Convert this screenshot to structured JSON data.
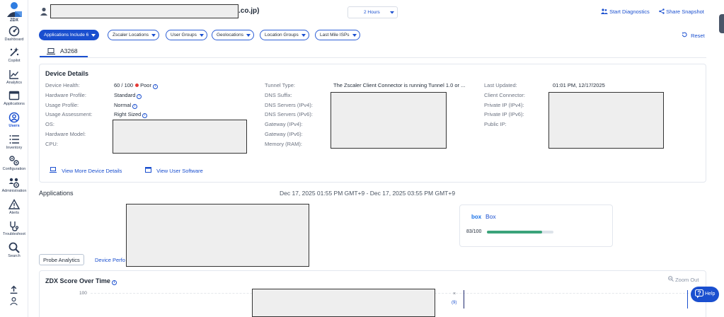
{
  "sidebar": {
    "logo_label": "ZDX",
    "items": [
      {
        "label": "Dashboard",
        "icon": "dashboard-icon"
      },
      {
        "label": "Copilot",
        "icon": "sparkle-icon"
      },
      {
        "label": "Analytics",
        "icon": "chart-icon"
      },
      {
        "label": "Applications",
        "icon": "window-icon"
      },
      {
        "label": "Users",
        "icon": "user-circle-icon",
        "active": true
      },
      {
        "label": "Inventory",
        "icon": "list-icon"
      },
      {
        "label": "Configuration",
        "icon": "gears-icon"
      },
      {
        "label": "Administration",
        "icon": "admin-icon"
      },
      {
        "label": "Alerts",
        "icon": "warning-icon"
      },
      {
        "label": "Troubleshoot",
        "icon": "troubleshoot-icon"
      },
      {
        "label": "Search",
        "icon": "search-icon"
      }
    ]
  },
  "header": {
    "domain_suffix": ".co.jp)",
    "time_range": "2 Hours",
    "start_diagnostics": "Start Diagnostics",
    "share_snapshot": "Share Snapshot"
  },
  "filters": {
    "chips": [
      "Applications Include 6",
      "Zscaler Locations",
      "User Groups",
      "Geolocations",
      "Location Groups",
      "Last Mile ISPs"
    ],
    "reset": "Reset"
  },
  "device_tab": {
    "label": "A3268"
  },
  "device_details": {
    "title": "Device Details",
    "col1": {
      "device_health_label": "Device Health:",
      "device_health_score": "60 / 100",
      "device_health_status": "Poor",
      "hardware_profile_label": "Hardware Profile:",
      "hardware_profile_value": "Standard",
      "usage_profile_label": "Usage Profile:",
      "usage_profile_value": "Normal",
      "usage_assessment_label": "Usage Assessment:",
      "usage_assessment_value": "Right Sized",
      "os_label": "OS:",
      "hardware_model_label": "Hardware Model:",
      "cpu_label": "CPU:"
    },
    "col2": {
      "tunnel_type_label": "Tunnel Type:",
      "tunnel_type_value": "The Zscaler Client Connector is running Tunnel 1.0 or ...",
      "dns_suffix_label": "DNS Suffix:",
      "dns_ipv4_label": "DNS Servers (IPv4):",
      "dns_ipv6_label": "DNS Servers (IPv6):",
      "gateway_ipv4_label": "Gateway (IPv4):",
      "gateway_ipv6_label": "Gateway (IPv6):",
      "memory_label": "Memory (RAM):"
    },
    "col3": {
      "last_updated_label": "Last Updated:",
      "last_updated_value": "01:01 PM, 12/17/2025",
      "client_connector_label": "Client Connector:",
      "private_ipv4_label": "Private IP (IPv4):",
      "private_ipv6_label": "Private IP (IPv6):",
      "public_ip_label": "Public IP:"
    },
    "view_more": "View More Device Details",
    "view_software": "View User Software"
  },
  "applications": {
    "title": "Applications",
    "range": "Dec 17, 2025 01:55 PM GMT+9 - Dec 17, 2025 03:55 PM GMT+9",
    "app": {
      "logo": "box",
      "name": "Box",
      "score": "83/100",
      "score_fraction": 0.83
    }
  },
  "tabs": {
    "probe": "Probe Analytics",
    "device_perf": "Device Perfo"
  },
  "zdx_score": {
    "title": "ZDX Score Over Time",
    "zoom_out": "Zoom Out",
    "y_max": "100",
    "close": "×",
    "marker": "(9)"
  },
  "help": {
    "label": "Help"
  },
  "colors": {
    "accent": "#1a4fcf",
    "poor": "#e53935",
    "score_bar": "#3aa37a"
  }
}
